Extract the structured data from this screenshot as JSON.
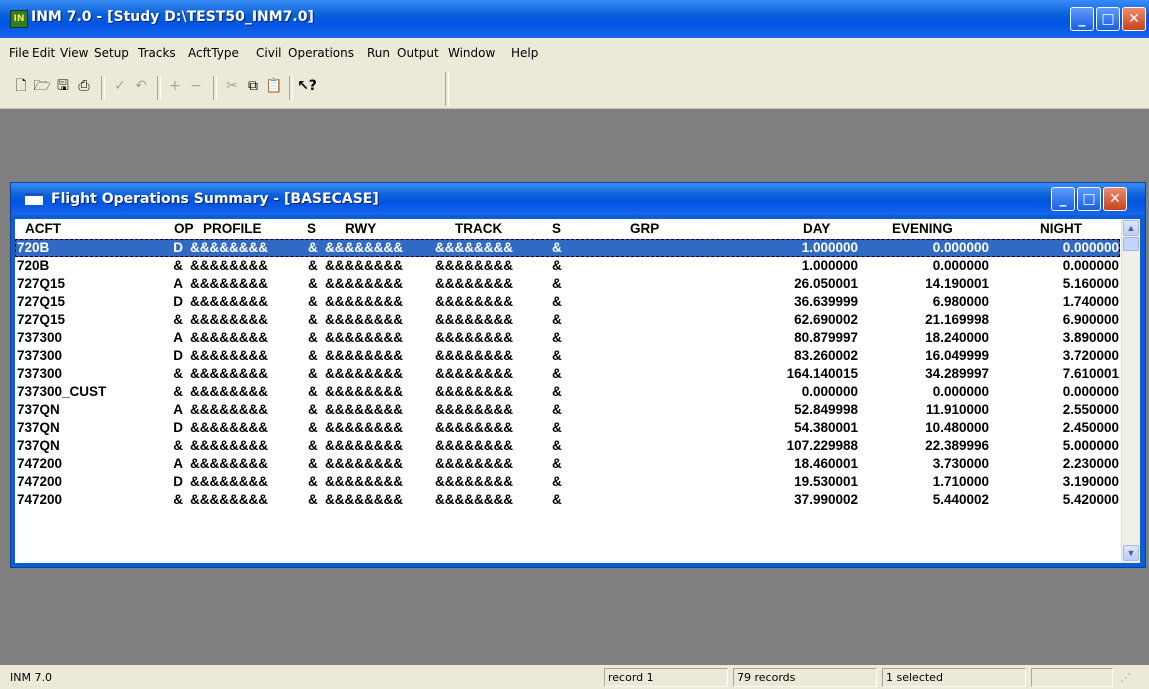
{
  "app": {
    "title": "INM 7.0 - [Study D:\\TEST50_INM7.0]",
    "icon_text": "IN"
  },
  "menu": [
    "File",
    "Edit",
    "View",
    "Setup",
    "Tracks",
    "AcftType",
    "Civil",
    "Operations",
    "Run",
    "Output",
    "Window",
    "Help"
  ],
  "toolbar": {
    "icons": [
      "new-icon",
      "open-icon",
      "save-icon",
      "print-icon",
      "check-icon",
      "undo-icon",
      "add-icon",
      "remove-icon",
      "cut-icon",
      "copy-icon",
      "paste-icon",
      "help-pointer-icon"
    ]
  },
  "child": {
    "title": "Flight Operations Summary - [BASECASE]"
  },
  "table": {
    "headers": {
      "acft": "ACFT",
      "op": "OP",
      "profile": "PROFILE",
      "s1": "S",
      "rwy": "RWY",
      "track": "TRACK",
      "s2": "S",
      "grp": "GRP",
      "day": "DAY",
      "evening": "EVENING",
      "night": "NIGHT"
    },
    "rows": [
      {
        "acft": "720B",
        "op": "D",
        "profile": "&&&&&&&&",
        "s1": "&",
        "rwy": "&&&&&&&&",
        "track": "&&&&&&&&",
        "s2": "&",
        "grp": "",
        "day": "1.000000",
        "evening": "0.000000",
        "night": "0.000000"
      },
      {
        "acft": "720B",
        "op": "&",
        "profile": "&&&&&&&&",
        "s1": "&",
        "rwy": "&&&&&&&&",
        "track": "&&&&&&&&",
        "s2": "&",
        "grp": "",
        "day": "1.000000",
        "evening": "0.000000",
        "night": "0.000000"
      },
      {
        "acft": "727Q15",
        "op": "A",
        "profile": "&&&&&&&&",
        "s1": "&",
        "rwy": "&&&&&&&&",
        "track": "&&&&&&&&",
        "s2": "&",
        "grp": "",
        "day": "26.050001",
        "evening": "14.190001",
        "night": "5.160000"
      },
      {
        "acft": "727Q15",
        "op": "D",
        "profile": "&&&&&&&&",
        "s1": "&",
        "rwy": "&&&&&&&&",
        "track": "&&&&&&&&",
        "s2": "&",
        "grp": "",
        "day": "36.639999",
        "evening": "6.980000",
        "night": "1.740000"
      },
      {
        "acft": "727Q15",
        "op": "&",
        "profile": "&&&&&&&&",
        "s1": "&",
        "rwy": "&&&&&&&&",
        "track": "&&&&&&&&",
        "s2": "&",
        "grp": "",
        "day": "62.690002",
        "evening": "21.169998",
        "night": "6.900000"
      },
      {
        "acft": "737300",
        "op": "A",
        "profile": "&&&&&&&&",
        "s1": "&",
        "rwy": "&&&&&&&&",
        "track": "&&&&&&&&",
        "s2": "&",
        "grp": "",
        "day": "80.879997",
        "evening": "18.240000",
        "night": "3.890000"
      },
      {
        "acft": "737300",
        "op": "D",
        "profile": "&&&&&&&&",
        "s1": "&",
        "rwy": "&&&&&&&&",
        "track": "&&&&&&&&",
        "s2": "&",
        "grp": "",
        "day": "83.260002",
        "evening": "16.049999",
        "night": "3.720000"
      },
      {
        "acft": "737300",
        "op": "&",
        "profile": "&&&&&&&&",
        "s1": "&",
        "rwy": "&&&&&&&&",
        "track": "&&&&&&&&",
        "s2": "&",
        "grp": "",
        "day": "164.140015",
        "evening": "34.289997",
        "night": "7.610001"
      },
      {
        "acft": "737300_CUST",
        "op": "&",
        "profile": "&&&&&&&&",
        "s1": "&",
        "rwy": "&&&&&&&&",
        "track": "&&&&&&&&",
        "s2": "&",
        "grp": "",
        "day": "0.000000",
        "evening": "0.000000",
        "night": "0.000000"
      },
      {
        "acft": "737QN",
        "op": "A",
        "profile": "&&&&&&&&",
        "s1": "&",
        "rwy": "&&&&&&&&",
        "track": "&&&&&&&&",
        "s2": "&",
        "grp": "",
        "day": "52.849998",
        "evening": "11.910000",
        "night": "2.550000"
      },
      {
        "acft": "737QN",
        "op": "D",
        "profile": "&&&&&&&&",
        "s1": "&",
        "rwy": "&&&&&&&&",
        "track": "&&&&&&&&",
        "s2": "&",
        "grp": "",
        "day": "54.380001",
        "evening": "10.480000",
        "night": "2.450000"
      },
      {
        "acft": "737QN",
        "op": "&",
        "profile": "&&&&&&&&",
        "s1": "&",
        "rwy": "&&&&&&&&",
        "track": "&&&&&&&&",
        "s2": "&",
        "grp": "",
        "day": "107.229988",
        "evening": "22.389996",
        "night": "5.000000"
      },
      {
        "acft": "747200",
        "op": "A",
        "profile": "&&&&&&&&",
        "s1": "&",
        "rwy": "&&&&&&&&",
        "track": "&&&&&&&&",
        "s2": "&",
        "grp": "",
        "day": "18.460001",
        "evening": "3.730000",
        "night": "2.230000"
      },
      {
        "acft": "747200",
        "op": "D",
        "profile": "&&&&&&&&",
        "s1": "&",
        "rwy": "&&&&&&&&",
        "track": "&&&&&&&&",
        "s2": "&",
        "grp": "",
        "day": "19.530001",
        "evening": "1.710000",
        "night": "3.190000"
      },
      {
        "acft": "747200",
        "op": "&",
        "profile": "&&&&&&&&",
        "s1": "&",
        "rwy": "&&&&&&&&",
        "track": "&&&&&&&&",
        "s2": "&",
        "grp": "",
        "day": "37.990002",
        "evening": "5.440002",
        "night": "5.420000"
      }
    ],
    "selected_index": 0
  },
  "status": {
    "app": "INM 7.0",
    "record": "record 1",
    "count": "79 records",
    "selected": "1 selected"
  },
  "colors": {
    "title_blue": "#0054e3",
    "selection": "#316ac5",
    "mdi_background": "#7f7f7f",
    "close_red": "#c8421a"
  }
}
